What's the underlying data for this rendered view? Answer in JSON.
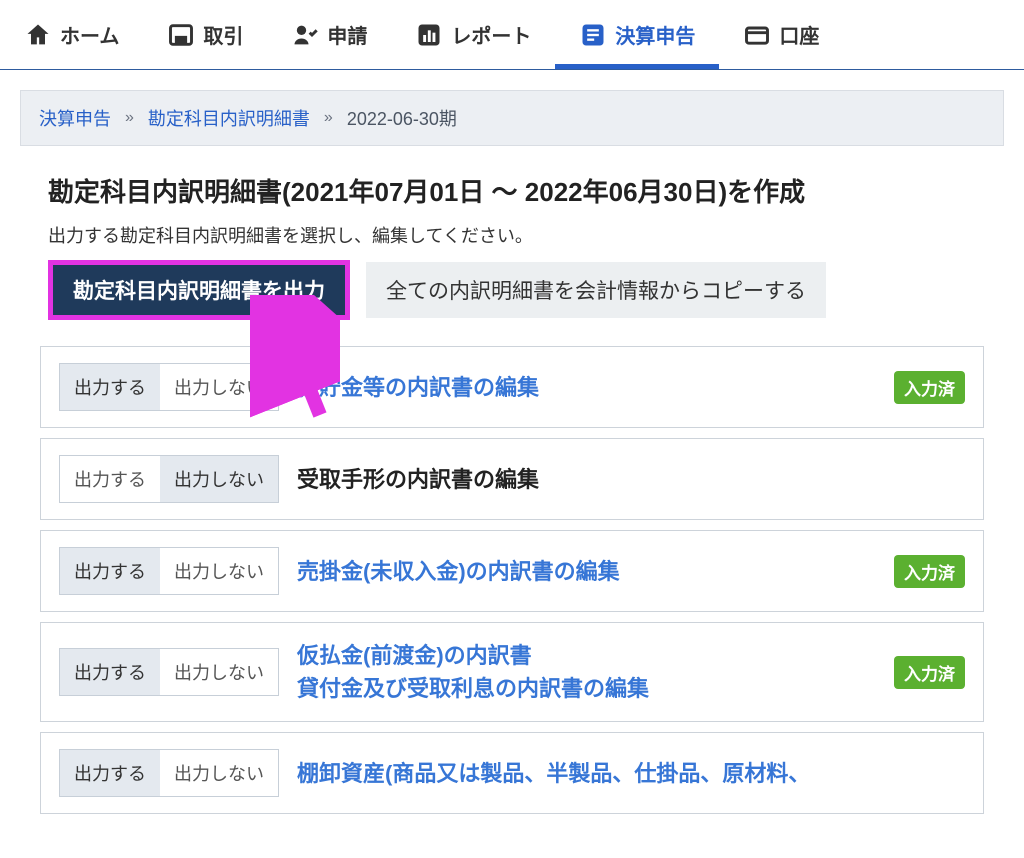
{
  "nav": {
    "items": [
      {
        "label": "ホーム",
        "icon": "home"
      },
      {
        "label": "取引",
        "icon": "transaction"
      },
      {
        "label": "申請",
        "icon": "application"
      },
      {
        "label": "レポート",
        "icon": "report"
      },
      {
        "label": "決算申告",
        "icon": "settlement",
        "active": true
      },
      {
        "label": "口座",
        "icon": "account"
      }
    ]
  },
  "breadcrumb": {
    "items": [
      "決算申告",
      "勘定科目内訳明細書",
      "2022-06-30期"
    ],
    "sep": "»"
  },
  "page": {
    "title": "勘定科目内訳明細書(2021年07月01日 〜 2022年06月30日)を作成",
    "subtitle": "出力する勘定科目内訳明細書を選択し、編集してください。"
  },
  "actions": {
    "primary": "勘定科目内訳明細書を出力",
    "secondary": "全ての内訳明細書を会計情報からコピーする"
  },
  "toggle": {
    "on": "出力する",
    "off": "出力しない"
  },
  "badge": {
    "entered": "入力済"
  },
  "items": [
    {
      "titles": [
        "預貯金等の内訳書の編集"
      ],
      "link": true,
      "output": true,
      "entered": true
    },
    {
      "titles": [
        "受取手形の内訳書の編集"
      ],
      "link": false,
      "output": false,
      "entered": false
    },
    {
      "titles": [
        "売掛金(未収入金)の内訳書の編集"
      ],
      "link": true,
      "output": true,
      "entered": true
    },
    {
      "titles": [
        "仮払金(前渡金)の内訳書",
        "貸付金及び受取利息の内訳書の編集"
      ],
      "link": true,
      "output": true,
      "entered": true
    },
    {
      "titles": [
        "棚卸資産(商品又は製品、半製品、仕掛品、原材料、"
      ],
      "link": true,
      "output": true,
      "entered": false
    }
  ]
}
